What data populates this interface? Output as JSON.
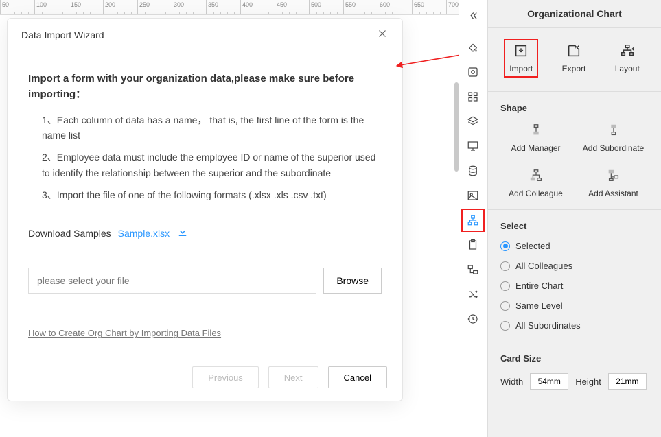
{
  "ruler": {
    "start": 50,
    "step": 10,
    "count": 60
  },
  "modal": {
    "title": "Data Import Wizard",
    "intro": "Import a form with your organization data,please make sure before importing：",
    "rules": [
      "1、Each column of data has a name， that is, the first line of the form is the name list",
      "2、Employee data must include the employee ID or name of the superior used to identify the relationship between the superior and the subordinate",
      "3、Import the file of one of the following formats (.xlsx .xls .csv .txt)"
    ],
    "download_label": "Download Samples",
    "sample_link": "Sample.xlsx",
    "file_placeholder": "please select your file",
    "browse": "Browse",
    "howto": "How to Create Org Chart by Importing Data Files",
    "prev": "Previous",
    "next": "Next",
    "cancel": "Cancel"
  },
  "tool_strip": [
    "collapse",
    "fill",
    "settings",
    "grid",
    "layers",
    "presentation",
    "database",
    "image",
    "org-chart",
    "clipboard",
    "arrange",
    "shuffle",
    "history"
  ],
  "active_tool_index": 8,
  "panel": {
    "title": "Organizational Chart",
    "top": {
      "import": "Import",
      "export": "Export",
      "layout": "Layout"
    },
    "shape": {
      "heading": "Shape",
      "items": [
        "Add Manager",
        "Add Subordinate",
        "Add Colleague",
        "Add Assistant"
      ]
    },
    "select": {
      "heading": "Select",
      "options": [
        "Selected",
        "All Colleagues",
        "Entire Chart",
        "Same Level",
        "All Subordinates"
      ],
      "checked": 0
    },
    "card": {
      "heading": "Card Size",
      "width_label": "Width",
      "width_value": "54mm",
      "height_label": "Height",
      "height_value": "21mm"
    }
  }
}
